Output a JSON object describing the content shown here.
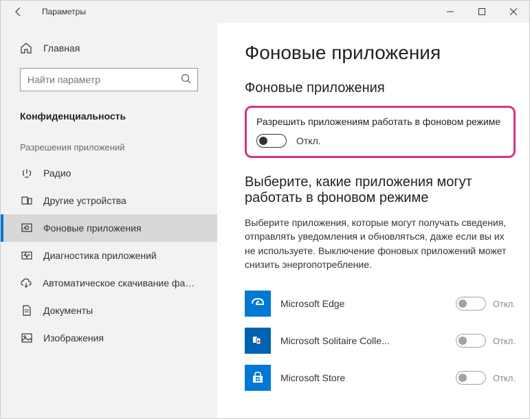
{
  "window": {
    "title": "Параметры"
  },
  "sidebar": {
    "home": "Главная",
    "search_placeholder": "Найти параметр",
    "category": "Конфиденциальность",
    "section": "Разрешения приложений",
    "items": [
      {
        "label": "Радио"
      },
      {
        "label": "Другие устройства"
      },
      {
        "label": "Фоновые приложения"
      },
      {
        "label": "Диагностика приложений"
      },
      {
        "label": "Автоматическое скачивание файлов"
      },
      {
        "label": "Документы"
      },
      {
        "label": "Изображения"
      }
    ]
  },
  "main": {
    "title": "Фоновые приложения",
    "subtitle": "Фоновые приложения",
    "permission_label": "Разрешить приложениям работать в фоновом режиме",
    "toggle_state": "Откл.",
    "choose_title": "Выберите, какие приложения могут работать в фоновом режиме",
    "description": "Выберите приложения, которые могут получать сведения, отправлять уведомления и обновляться, даже если вы их не используете. Выключение фоновых приложений может снизить энергопотребление.",
    "apps": [
      {
        "name": "Microsoft Edge",
        "state": "Откл."
      },
      {
        "name": "Microsoft Solitaire Colle...",
        "state": "Откл."
      },
      {
        "name": "Microsoft Store",
        "state": "Откл."
      }
    ]
  }
}
